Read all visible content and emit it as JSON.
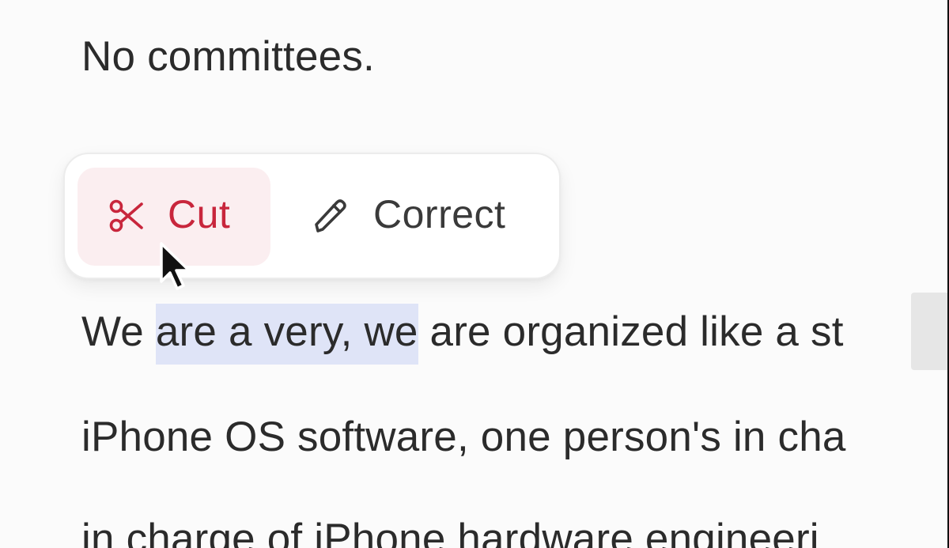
{
  "transcript": {
    "lines": [
      "No committees.",
      "iPhone OS software, one person's in cha",
      "in charge of iPhone hardware engineeri"
    ],
    "selected_line": {
      "before": "We ",
      "selected": "are a very, we",
      "after": " are organized like a st"
    }
  },
  "popover": {
    "cut_label": "Cut",
    "cut_icon": "scissors-icon",
    "correct_label": "Correct",
    "correct_icon": "pencil-icon"
  },
  "colors": {
    "cut_accent": "#c8263c",
    "cut_bg": "#fbeef0",
    "selection_bg": "#dfe4f7",
    "text": "#2b2b2b"
  }
}
